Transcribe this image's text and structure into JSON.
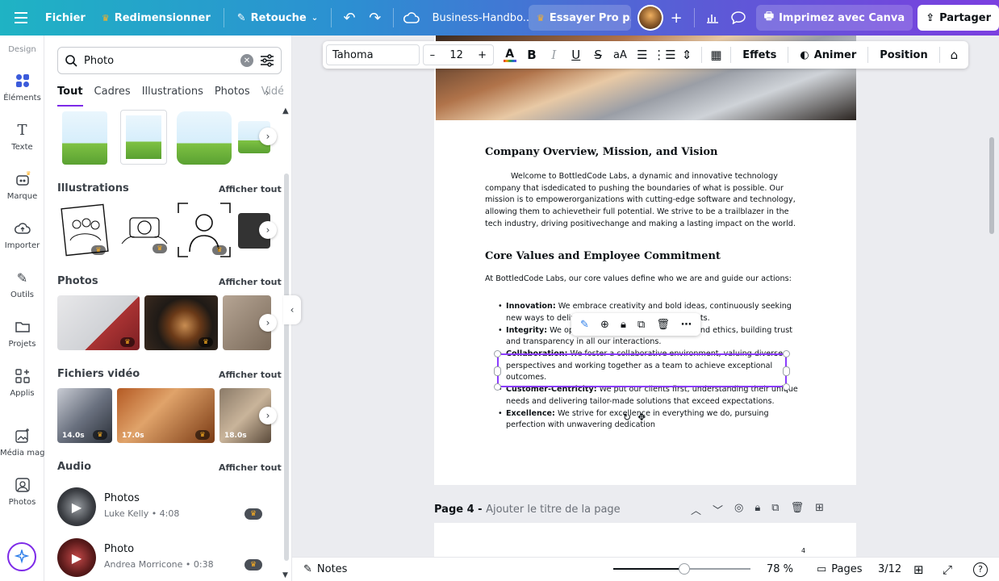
{
  "topbar": {
    "file": "Fichier",
    "resize": "Redimensionner",
    "edit": "Retouche",
    "title": "Business-Handbo...",
    "pro": "Essayer Pro p...",
    "print": "Imprimez avec Canva",
    "share": "Partager"
  },
  "rail": {
    "design": "Design",
    "items": [
      "Éléments",
      "Texte",
      "Marque",
      "Importer",
      "Outils",
      "Projets",
      "Applis",
      "Média magi...",
      "Photos"
    ]
  },
  "panel": {
    "search_value": "Photo",
    "tabs": [
      "Tout",
      "Cadres",
      "Illustrations",
      "Photos",
      "Vidé"
    ],
    "see_all": "Afficher tout",
    "sections": {
      "illustrations": "Illustrations",
      "photos": "Photos",
      "videos": "Fichiers vidéo",
      "audio": "Audio"
    },
    "video_durations": [
      "14.0s",
      "17.0s",
      "18.0s"
    ],
    "audio": [
      {
        "title": "Photos",
        "sub": "Luke Kelly • 4:08"
      },
      {
        "title": "Photo",
        "sub": "Andrea Morricone • 0:38"
      }
    ]
  },
  "text_toolbar": {
    "font": "Tahoma",
    "size": "12",
    "effects": "Effets",
    "animate": "Animer",
    "position": "Position"
  },
  "document": {
    "h1": "Company Overview, Mission, and Vision",
    "p1": "Welcome to BottledCode Labs, a dynamic and innovative technology company that isdedicated to pushing the boundaries of what is possible. Our mission is to empowerorganizations with cutting-edge software and technology, allowing them to achievetheir full potential. We strive to be a trailblazer in the tech industry, driving positivechange and making a lasting impact on the world.",
    "h2": "Core Values and Employee Commitment",
    "p2": "At BottledCode Labs, our core values define who we are and guide our actions:",
    "bullets": [
      {
        "label": "Innovation:",
        "text": " We embrace creativity and bold ideas, continuously seeking new ways to deliver exceptional value to our clients."
      },
      {
        "label": "Integrity:",
        "text": " We operate with the utmost integrity and ethics, building trust and transparency in all our interactions."
      },
      {
        "label": "Collaboration:",
        "text": " We foster a collaborative environment, valuing diverse perspectives and working together as a team to achieve exceptional outcomes."
      },
      {
        "label": "Customer-Centricity:",
        "text": " We put our clients first, understanding their unique needs and delivering tailor-made solutions that exceed expectations."
      },
      {
        "label": "Excellence:",
        "text": " We strive for excellence in everything we do, pursuing perfection with unwavering dedication"
      }
    ]
  },
  "page_label": {
    "prefix": "Page 4 - ",
    "placeholder": "Ajouter le titre de la page"
  },
  "page2_number": "4",
  "footer": {
    "notes": "Notes",
    "zoom": "78 %",
    "zoom_fraction": 0.52,
    "pages": "Pages",
    "page_count": "3/12"
  }
}
